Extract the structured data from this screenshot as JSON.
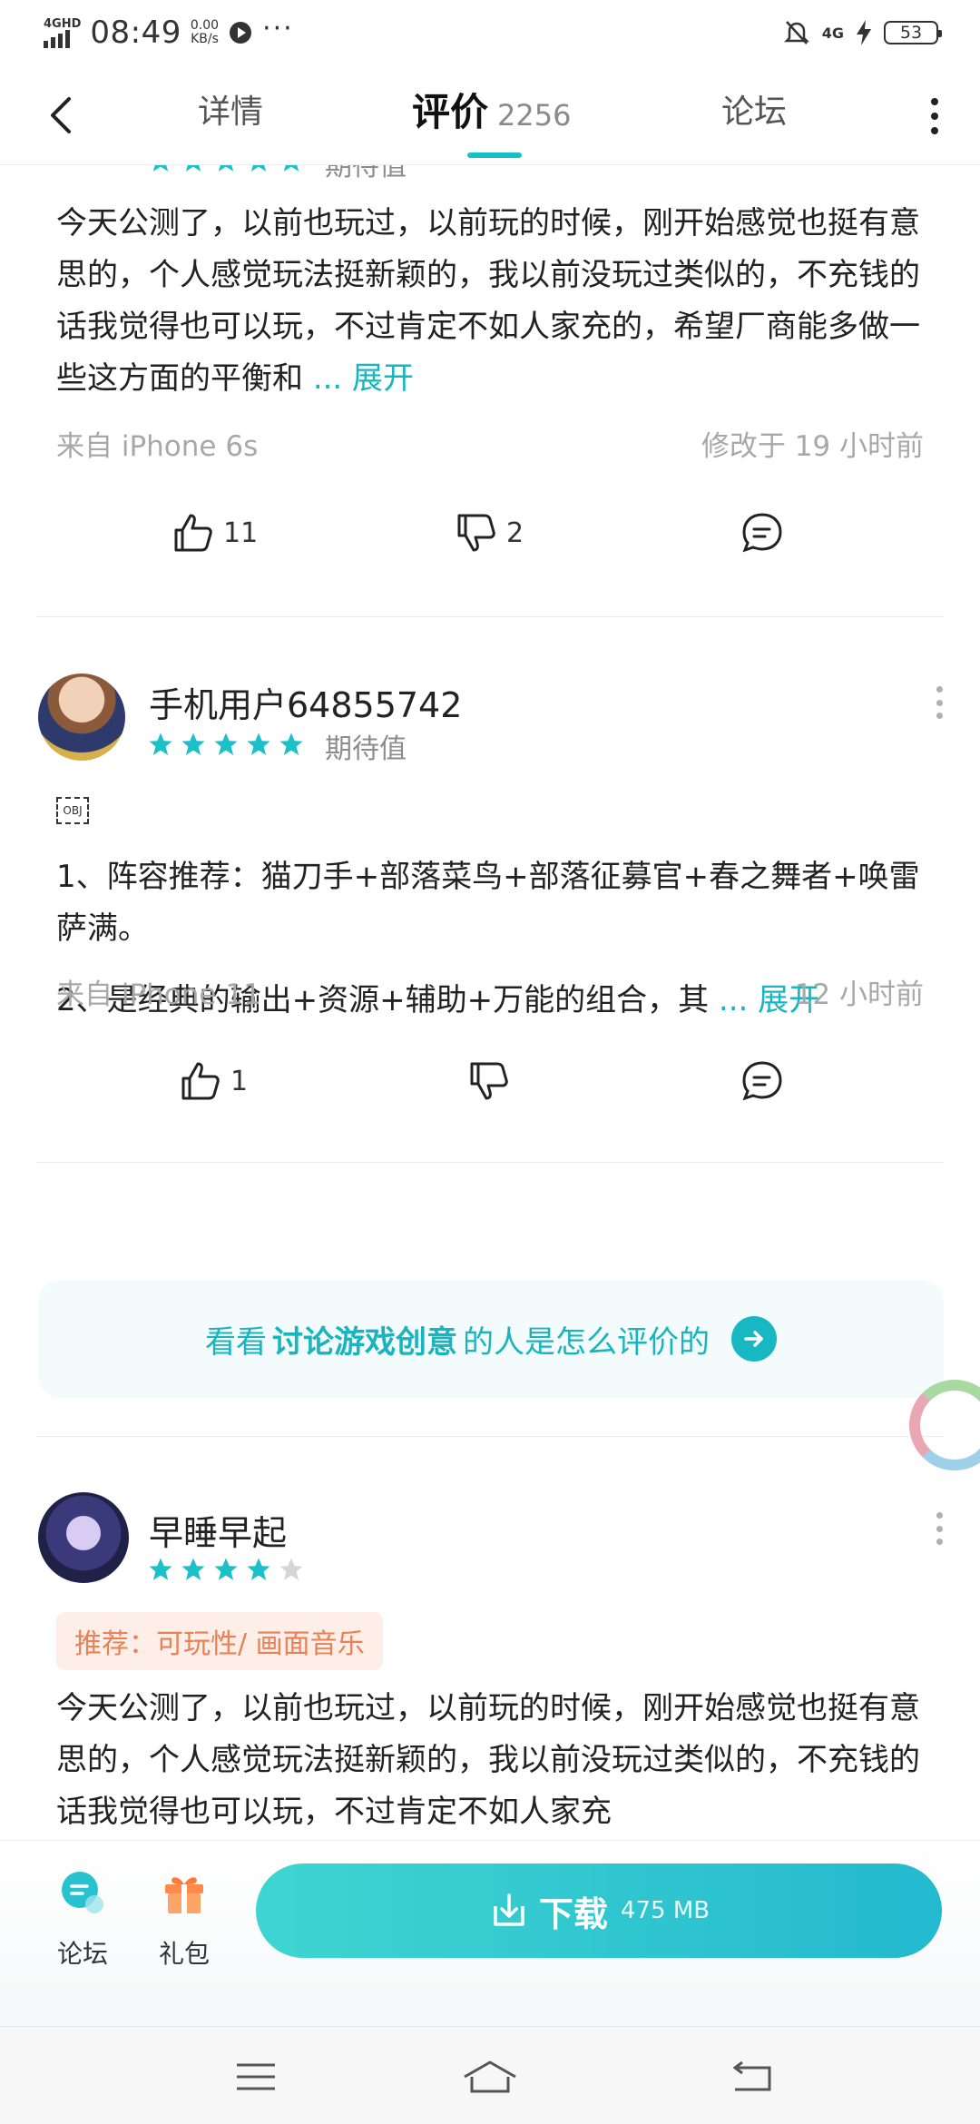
{
  "status_bar": {
    "network": "4GHD",
    "time": "08:49",
    "speed_value": "0.00",
    "speed_unit": "KB/s",
    "more": "···",
    "signal_right": "4G",
    "battery": "53"
  },
  "nav": {
    "tab_detail": "详情",
    "tab_reviews": "评价",
    "reviews_count": "2256",
    "tab_forum": "论坛"
  },
  "reviews": [
    {
      "stars_label": "期待值",
      "text": "今天公测了，以前也玩过，以前玩的时候，刚开始感觉也挺有意思的，个人感觉玩法挺新颖的，我以前没玩过类似的，不充钱的话我觉得也可以玩，不过肯定不如人家充的，希望厂商能多做一些这方面的平衡和",
      "expand": "... 展开",
      "source": "来自 iPhone 6s",
      "time": "修改于 19 小时前",
      "likes": "11",
      "dislikes": "2",
      "rating": 5
    },
    {
      "username": "手机用户64855742",
      "stars_label": "期待值",
      "obj": "OBJ",
      "para1": "1、阵容推荐：猫刀手+部落菜鸟+部落征募官+春之舞者+唤雷萨满。",
      "para2": "2、是经典的输出+资源+辅助+万能的组合，其",
      "expand": "... 展开",
      "source": "来自 iPhone 11",
      "time": "12 小时前",
      "likes": "1",
      "dislikes": "",
      "rating": 5
    },
    {
      "username": "早睡早起",
      "tag": "推荐：可玩性/ 画面音乐",
      "text": "今天公测了，以前也玩过，以前玩的时候，刚开始感觉也挺有意思的，个人感觉玩法挺新颖的，我以前没玩过类似的，不充钱的话我觉得也可以玩，不过肯定不如人家充",
      "rating": 4
    }
  ],
  "discuss": {
    "prefix": "看看",
    "highlight": "讨论游戏创意",
    "suffix": "的人是怎么评价的"
  },
  "bottom": {
    "forum": "论坛",
    "gift": "礼包",
    "download": "下载",
    "size": "475 MB"
  },
  "colors": {
    "accent": "#14c1c7",
    "star": "#1cc0c8",
    "tag_bg": "#fdeee7",
    "tag_text": "#e98056"
  }
}
